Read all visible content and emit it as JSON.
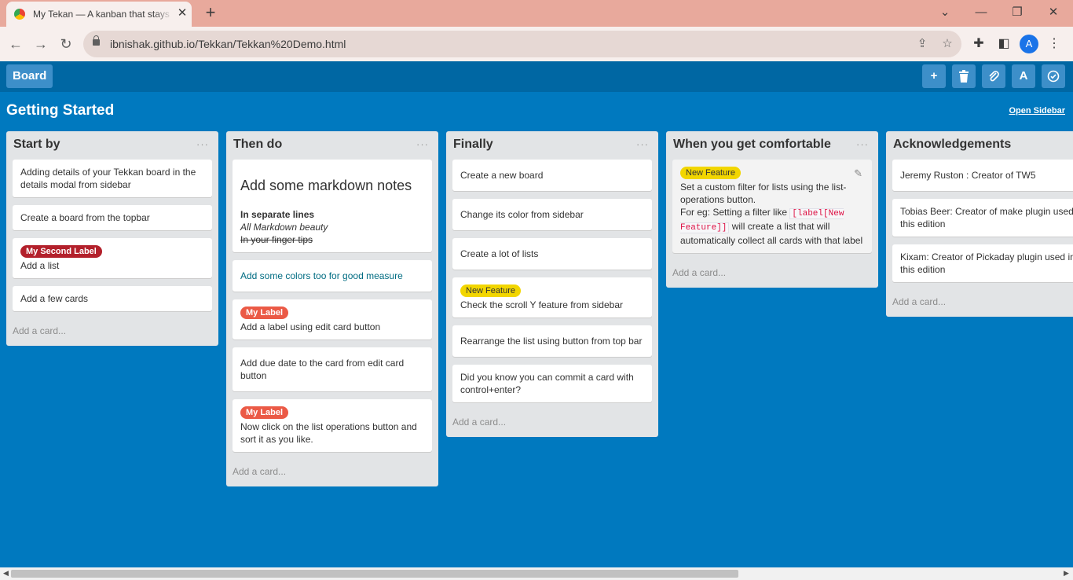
{
  "browser": {
    "tab_title": "My Tekan — A kanban that stays",
    "tab_close": "✕",
    "new_tab": "+",
    "url": "ibnishak.github.io/Tekkan/Tekkan%20Demo.html",
    "avatar_letter": "A",
    "window_controls": {
      "minimize": "—",
      "restore": "❐",
      "close": "✕",
      "dropdown": "⌄"
    }
  },
  "app": {
    "board_button": "Board",
    "toolbar": {
      "add": "+",
      "delete": "🗑",
      "attach": "📎",
      "font": "A",
      "check": "✓"
    },
    "board_title": "Getting Started",
    "open_sidebar": "Open Sidebar",
    "add_card": "Add a card...",
    "list_menu": "···",
    "colors": {
      "board_bg": "#0079bf",
      "topbar_bg": "#0067a3",
      "label_red": "#b3202b",
      "label_coral": "#eb5a46",
      "label_yellow": "#f2d600",
      "link_teal": "#006c82"
    }
  },
  "lists": [
    {
      "title": "Start by",
      "cards": [
        {
          "text": "Adding details of your Tekkan board in the details modal from sidebar"
        },
        {
          "text": "Create a board from the topbar"
        },
        {
          "label": "My Second Label",
          "text": "Add a list"
        },
        {
          "text": "Add a few cards"
        }
      ]
    },
    {
      "title": "Then do",
      "cards": [
        {
          "heading": "Add some markdown notes",
          "bold": "In separate lines",
          "italic": "All Markdown beauty",
          "strike": "In your finger tips"
        },
        {
          "text": "Add some colors too for good measure"
        },
        {
          "label": "My Label",
          "text": "Add a label using edit card button"
        },
        {
          "text": "Add due date to the card from edit card button"
        },
        {
          "label": "My Label",
          "text": "Now click on the list operations button and sort it as you like."
        }
      ]
    },
    {
      "title": "Finally",
      "cards": [
        {
          "text": "Create a new board"
        },
        {
          "text": "Change its color from sidebar"
        },
        {
          "text": "Create a lot of lists"
        },
        {
          "label": "New Feature",
          "text": "Check the scroll Y feature from sidebar"
        },
        {
          "text": "Rearrange the list using button from top bar"
        },
        {
          "text": "Did you know you can commit a card with control+enter?"
        }
      ]
    },
    {
      "title": "When you get comfortable",
      "cards": [
        {
          "label": "New Feature",
          "line1": "Set a custom filter for lists using the list-operations button.",
          "line2a": "For eg: Setting a filter like",
          "code": "[label[New Feature]]",
          "line2b": "will create a list that will automatically collect all cards with that label",
          "edit_icon": "✎"
        }
      ]
    },
    {
      "title": "Acknowledgements",
      "cards": [
        {
          "text": "Jeremy Ruston : Creator of TW5"
        },
        {
          "text": "Tobias Beer: Creator of make plugin used in this edition"
        },
        {
          "text": "Kixam: Creator of Pickaday plugin used in this edition"
        }
      ]
    }
  ]
}
